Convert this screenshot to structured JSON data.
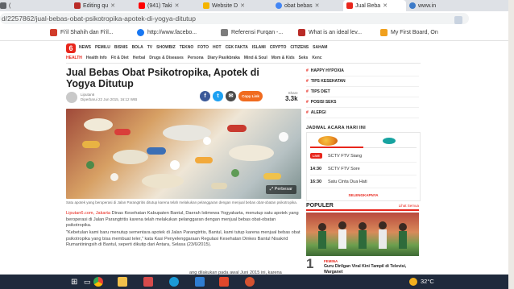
{
  "browser": {
    "tabs": [
      {
        "label": "(",
        "icon": "tab-icon-partial",
        "color": "#5f6368"
      },
      {
        "label": "Editing qu",
        "icon": "quora-icon",
        "color": "#b92b27"
      },
      {
        "label": "(941) Taki",
        "icon": "youtube-icon",
        "color": "#ff0000"
      },
      {
        "label": "Website D",
        "icon": "website-icon",
        "color": "#f4b400"
      },
      {
        "label": "obat bebas",
        "icon": "google-icon",
        "color": "#4285f4"
      },
      {
        "label": "Jual Beba",
        "icon": "liputan6-icon",
        "color": "#e8261c",
        "active": true
      },
      {
        "label": "www.in",
        "icon": "globe-icon",
        "color": "#3c7ac8"
      }
    ],
    "url": "d/2257862/jual-bebas-obat-psikotropika-apotek-di-yogya-ditutup",
    "bookmarks": [
      {
        "label": "Fi'il Shahih dan Fi'il...",
        "icon": "bookmark-icon-1",
        "color": "#d13b2a"
      },
      {
        "label": "http://www.facebo...",
        "icon": "facebook-icon",
        "color": "#1877f2"
      },
      {
        "label": "Referensi Furqan -...",
        "icon": "bookmark-icon-3",
        "color": "#7c7c7c"
      },
      {
        "label": "What is an ideal lev...",
        "icon": "quora-icon",
        "color": "#b92b27"
      },
      {
        "label": "My First Board, On",
        "icon": "trello-icon",
        "color": "#f0a01e"
      }
    ]
  },
  "site": {
    "logo": "6",
    "topnav": [
      "NEWS",
      "PEMILU",
      "BISNIS",
      "BOLA",
      "TV",
      "SHOWBIZ",
      "TEKNO",
      "FOTO",
      "HOT",
      "CEK FAKTA",
      "ISLAMI",
      "CRYPTO",
      "CITIZENS",
      "SAHAM"
    ],
    "subnav": [
      "HEALTH",
      "Health Info",
      "Fit & Diet",
      "Herbal",
      "Drugs & Diseases",
      "Persona",
      "Diary Pasikbraka",
      "Mind & Soul",
      "Mom & Kids",
      "Seks",
      "Kenc"
    ]
  },
  "article": {
    "title": "Jual Bebas Obat Psikotropika, Apotek di Yogya Ditutup",
    "author": "Liputan6",
    "date": "Diperbarui 22 Jun 2015, 16:12 WIB",
    "share_label": "Share",
    "share_count": "3.3k",
    "copy_link": "Copy Link",
    "zoom_label": "Perbesar",
    "caption": "Satu apotek yang beroperasi di Jalan Parangtritis ditutup karena telah melakukan pelanggaran dengan menjual bebas obat-obatan psikotropika.",
    "paragraphs": [
      {
        "link": "Liputan6.com, Jakarta",
        "text": " Dinas Kesehatan Kabupaten Bantul, Daerah Istimewa Yogyakarta, menutup satu apotek yang beroperasi di Jalan Parangtritis karena telah melakukan pelanggaran dengan menjual bebas obat-obatan psikotropika."
      },
      {
        "link": "",
        "text": "\"Kebetulan kami baru menutup sementara apotek di Jalan Parangtritis, Bantul, kami tutup karena menjual bebas obat psikotropika yang bisa membuat teler,\" kata Kasi Penyelenggaraan Regulasi Kesehatan Dinkes Bantul Nisakrid Rumantiningsih di Bantul, seperti dikutip dari Antara, Selasa (23/6/2015)."
      }
    ],
    "bottom_line": "ang dilakukan pada awal Juni 2015 ini, karena"
  },
  "sidebar": {
    "links": [
      "HAPPY HYPOXIA",
      "TIPS KESEHATAN",
      "TIPS DIET",
      "POSISI SEKS",
      "ALERGI"
    ],
    "schedule_title": "JADWAL ACARA HARI INI",
    "schedule": [
      {
        "time": "LIVE",
        "program": "SCTV FTV Siang",
        "live": true
      },
      {
        "time": "14:30",
        "program": "SCTV FTV Sore"
      },
      {
        "time": "16:30",
        "program": "Satu Cinta Dua Hati"
      }
    ],
    "schedule_more": "SELENGKAPNYA",
    "popular_title": "POPULER",
    "popular_all": "Lihat Semua",
    "popular_item": {
      "rank": "1",
      "category": "FEMINA",
      "title": "Guru Dirilgan Viral Kini Tampil di Televisi, Warganet"
    }
  },
  "taskbar": {
    "icons": [
      "windows-start-icon",
      "task-view-icon",
      "chrome-icon",
      "file-explorer-icon",
      "store-icon",
      "edge-icon",
      "mail-icon",
      "office-icon",
      "powerpoint-icon"
    ],
    "temperature": "32°C"
  }
}
